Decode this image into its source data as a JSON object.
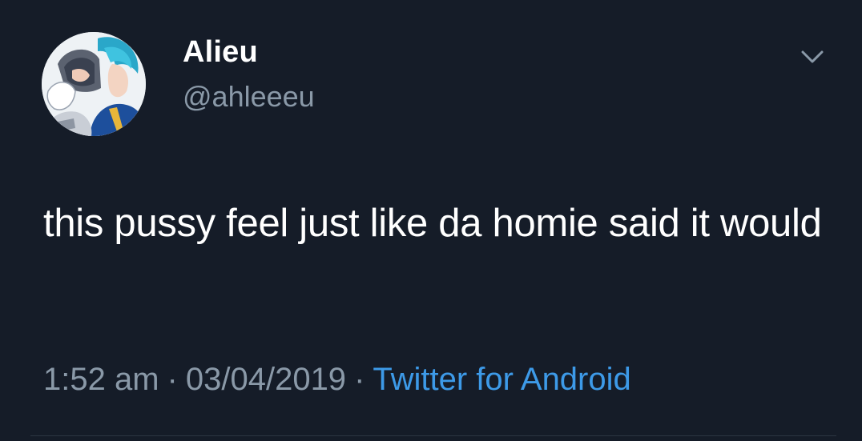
{
  "tweet": {
    "display_name": "Alieu",
    "handle": "@ahleeeu",
    "text": "this pussy feel just like da homie said it would",
    "time": "1:52 am",
    "separator": "·",
    "date": "03/04/2019",
    "source": "Twitter for Android"
  },
  "icons": {
    "menu": "chevron-down-icon",
    "avatar": "anime-avatar-image"
  },
  "colors": {
    "background": "#151c28",
    "primary_text": "#ffffff",
    "secondary_text": "#8a99a8",
    "link": "#3d9ae8"
  }
}
